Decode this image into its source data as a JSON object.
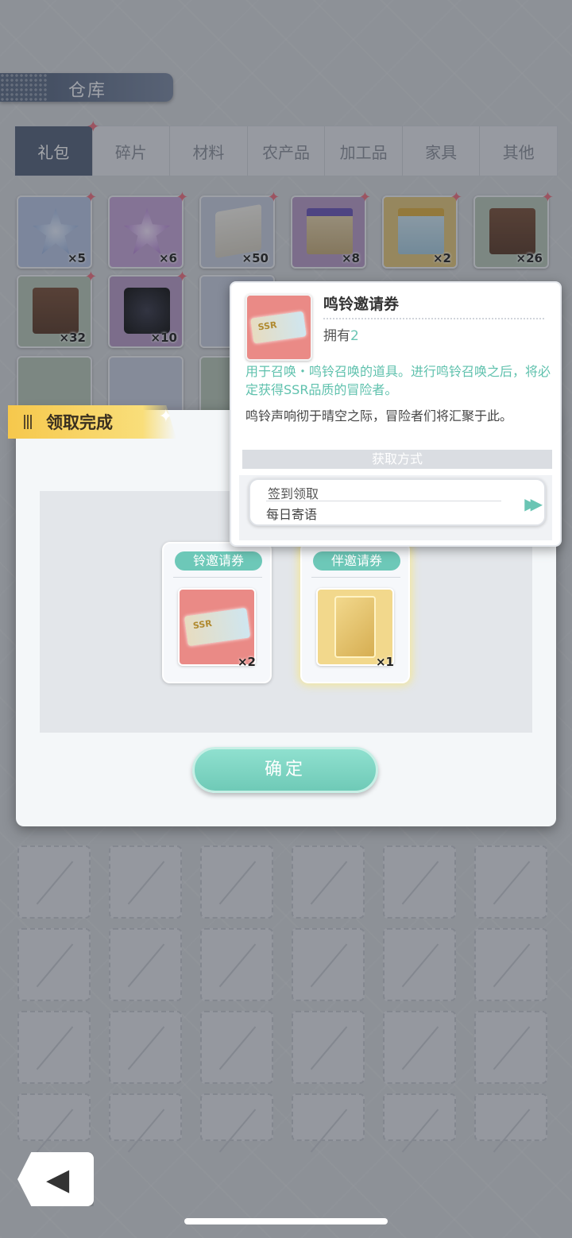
{
  "header": {
    "title": "仓库"
  },
  "tabs": [
    {
      "label": "礼包",
      "active": true
    },
    {
      "label": "碎片"
    },
    {
      "label": "材料"
    },
    {
      "label": "农产品"
    },
    {
      "label": "加工品"
    },
    {
      "label": "家具"
    },
    {
      "label": "其他"
    }
  ],
  "items": [
    {
      "count": "×5",
      "color": "#b9c7e6"
    },
    {
      "count": "×6",
      "color": "#c7a6d9"
    },
    {
      "count": "×50",
      "color": "#c8cfe0"
    },
    {
      "count": "×8",
      "color": "#b89cc9"
    },
    {
      "count": "×2",
      "color": "#e6c97a"
    },
    {
      "count": "×26",
      "color": "#b8c9b8"
    },
    {
      "count": "×32",
      "color": "#b8c9b8"
    },
    {
      "count": "×10",
      "color": "#b89cc9"
    }
  ],
  "claim": {
    "title": "领取完成",
    "rewards": [
      {
        "name": "鸣铃邀请券",
        "visible_name": "铃邀请券",
        "count": "×2"
      },
      {
        "name": "同伴邀请券",
        "visible_name": "伴邀请券",
        "count": "×1"
      }
    ],
    "confirm_label": "确定"
  },
  "tooltip": {
    "name": "鸣铃邀请券",
    "own_label": "拥有",
    "own_count": "2",
    "description": "用于召唤・鸣铃召唤的道具。进行鸣铃召唤之后，将必定获得SSR品质的冒险者。",
    "flavor": "鸣铃声响彻于晴空之际，冒险者们将汇聚于此。",
    "source_header": "获取方式",
    "source_line1": "签到领取",
    "source_line2": "每日寄语"
  },
  "colors": {
    "accent": "#6dc8b8",
    "tab_active": "#55637b",
    "claim_banner": "#f6c84c"
  },
  "icons": {
    "back": "back-arrow-icon",
    "go": "fast-forward-icon"
  }
}
